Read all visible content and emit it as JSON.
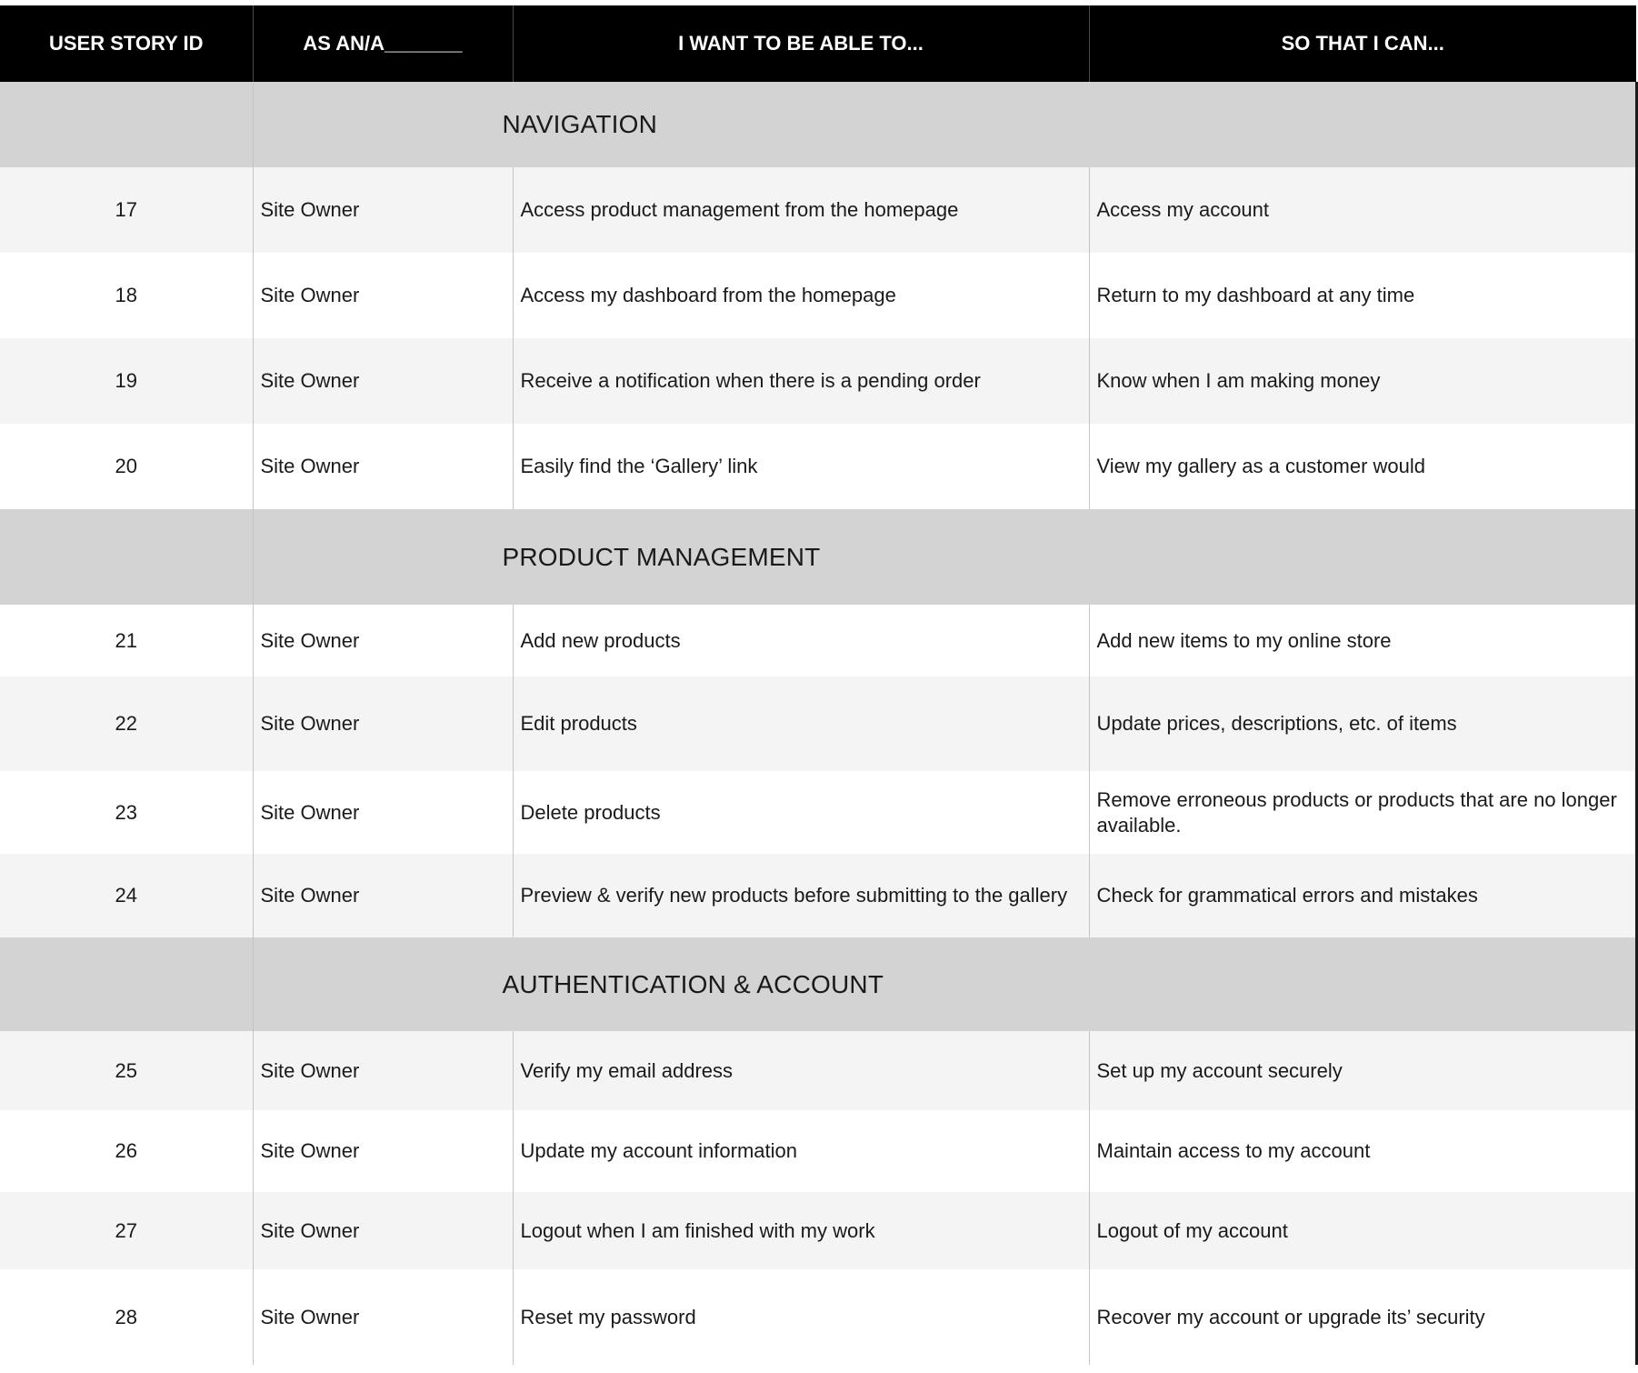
{
  "headers": {
    "id": "USER STORY ID",
    "as": "AS AN/A_______",
    "want": "I WANT TO BE ABLE TO...",
    "so": "SO THAT I CAN..."
  },
  "sections": [
    {
      "title": "NAVIGATION",
      "rows": [
        {
          "id": "17",
          "as": "Site Owner",
          "want": "Access product management from the homepage",
          "so": "Access my account"
        },
        {
          "id": "18",
          "as": "Site Owner",
          "want": "Access my dashboard from the homepage",
          "so": "Return to my dashboard at any time"
        },
        {
          "id": "19",
          "as": "Site Owner",
          "want": "Receive a notification when there is a pending order",
          "so": "Know when I am making money"
        },
        {
          "id": "20",
          "as": "Site Owner",
          "want": "Easily find the ‘Gallery’ link",
          "so": "View my gallery as a customer would"
        }
      ]
    },
    {
      "title": "PRODUCT MANAGEMENT",
      "rows": [
        {
          "id": "21",
          "as": "Site Owner",
          "want": "Add new products",
          "so": "Add new items to my online store"
        },
        {
          "id": "22",
          "as": "Site Owner",
          "want": "Edit products",
          "so": "Update prices, descriptions, etc. of items"
        },
        {
          "id": "23",
          "as": "Site Owner",
          "want": "Delete products",
          "so": "Remove erroneous products or products that are no longer available."
        },
        {
          "id": "24",
          "as": "Site Owner",
          "want": "Preview & verify new products before submitting to the gallery",
          "so": "Check for grammatical errors and mistakes"
        }
      ]
    },
    {
      "title": "AUTHENTICATION & ACCOUNT",
      "rows": [
        {
          "id": "25",
          "as": "Site Owner",
          "want": "Verify my email address",
          "so": "Set up my account securely"
        },
        {
          "id": "26",
          "as": "Site Owner",
          "want": "Update my account information",
          "so": "Maintain access to my account"
        },
        {
          "id": "27",
          "as": "Site Owner",
          "want": "Logout when I am finished with my work",
          "so": "Logout of my account"
        },
        {
          "id": "28",
          "as": "Site Owner",
          "want": "Reset my password",
          "so": "Recover my account or upgrade its’ security"
        }
      ]
    }
  ]
}
